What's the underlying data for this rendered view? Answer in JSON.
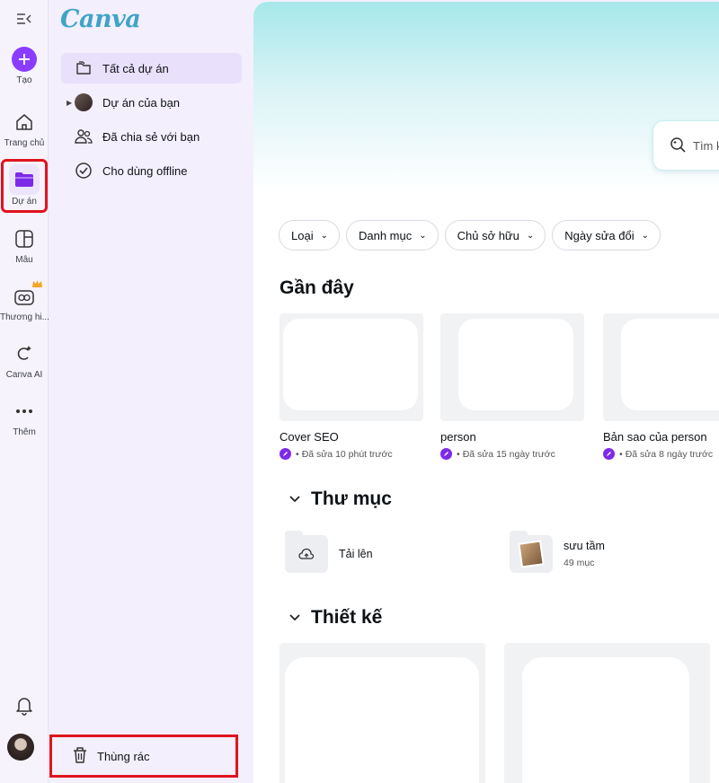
{
  "rail": {
    "items": [
      {
        "label": "Tạo"
      },
      {
        "label": "Trang chủ"
      },
      {
        "label": "Dự án"
      },
      {
        "label": "Mẫu"
      },
      {
        "label": "Thương hi..."
      },
      {
        "label": "Canva AI"
      },
      {
        "label": "Thêm"
      }
    ]
  },
  "brand": {
    "logo": "Canva"
  },
  "sidebar": {
    "items": [
      {
        "label": "Tất cả dự án"
      },
      {
        "label": "Dự án của bạn"
      },
      {
        "label": "Đã chia sẻ với bạn"
      },
      {
        "label": "Cho dùng offline"
      }
    ],
    "trash_label": "Thùng rác"
  },
  "search": {
    "placeholder": "Tìm k"
  },
  "filters": [
    "Loại",
    "Danh mục",
    "Chủ sở hữu",
    "Ngày sửa đổi"
  ],
  "recent": {
    "heading": "Gần đây",
    "items": [
      {
        "title": "Cover SEO",
        "meta": "Đã sửa 10 phút trước"
      },
      {
        "title": "person",
        "meta": "Đã sửa 15 ngày trước"
      },
      {
        "title": "Bản sao của person",
        "meta": "Đã sửa 8 ngày trước"
      }
    ]
  },
  "folders": {
    "heading": "Thư mục",
    "items": [
      {
        "name": "Tải lên",
        "count": ""
      },
      {
        "name": "sưu tầm",
        "count": "49 mục"
      }
    ]
  },
  "designs": {
    "heading": "Thiết kế"
  },
  "colors": {
    "accent": "#8b3dff",
    "highlight": "#e0141e"
  }
}
